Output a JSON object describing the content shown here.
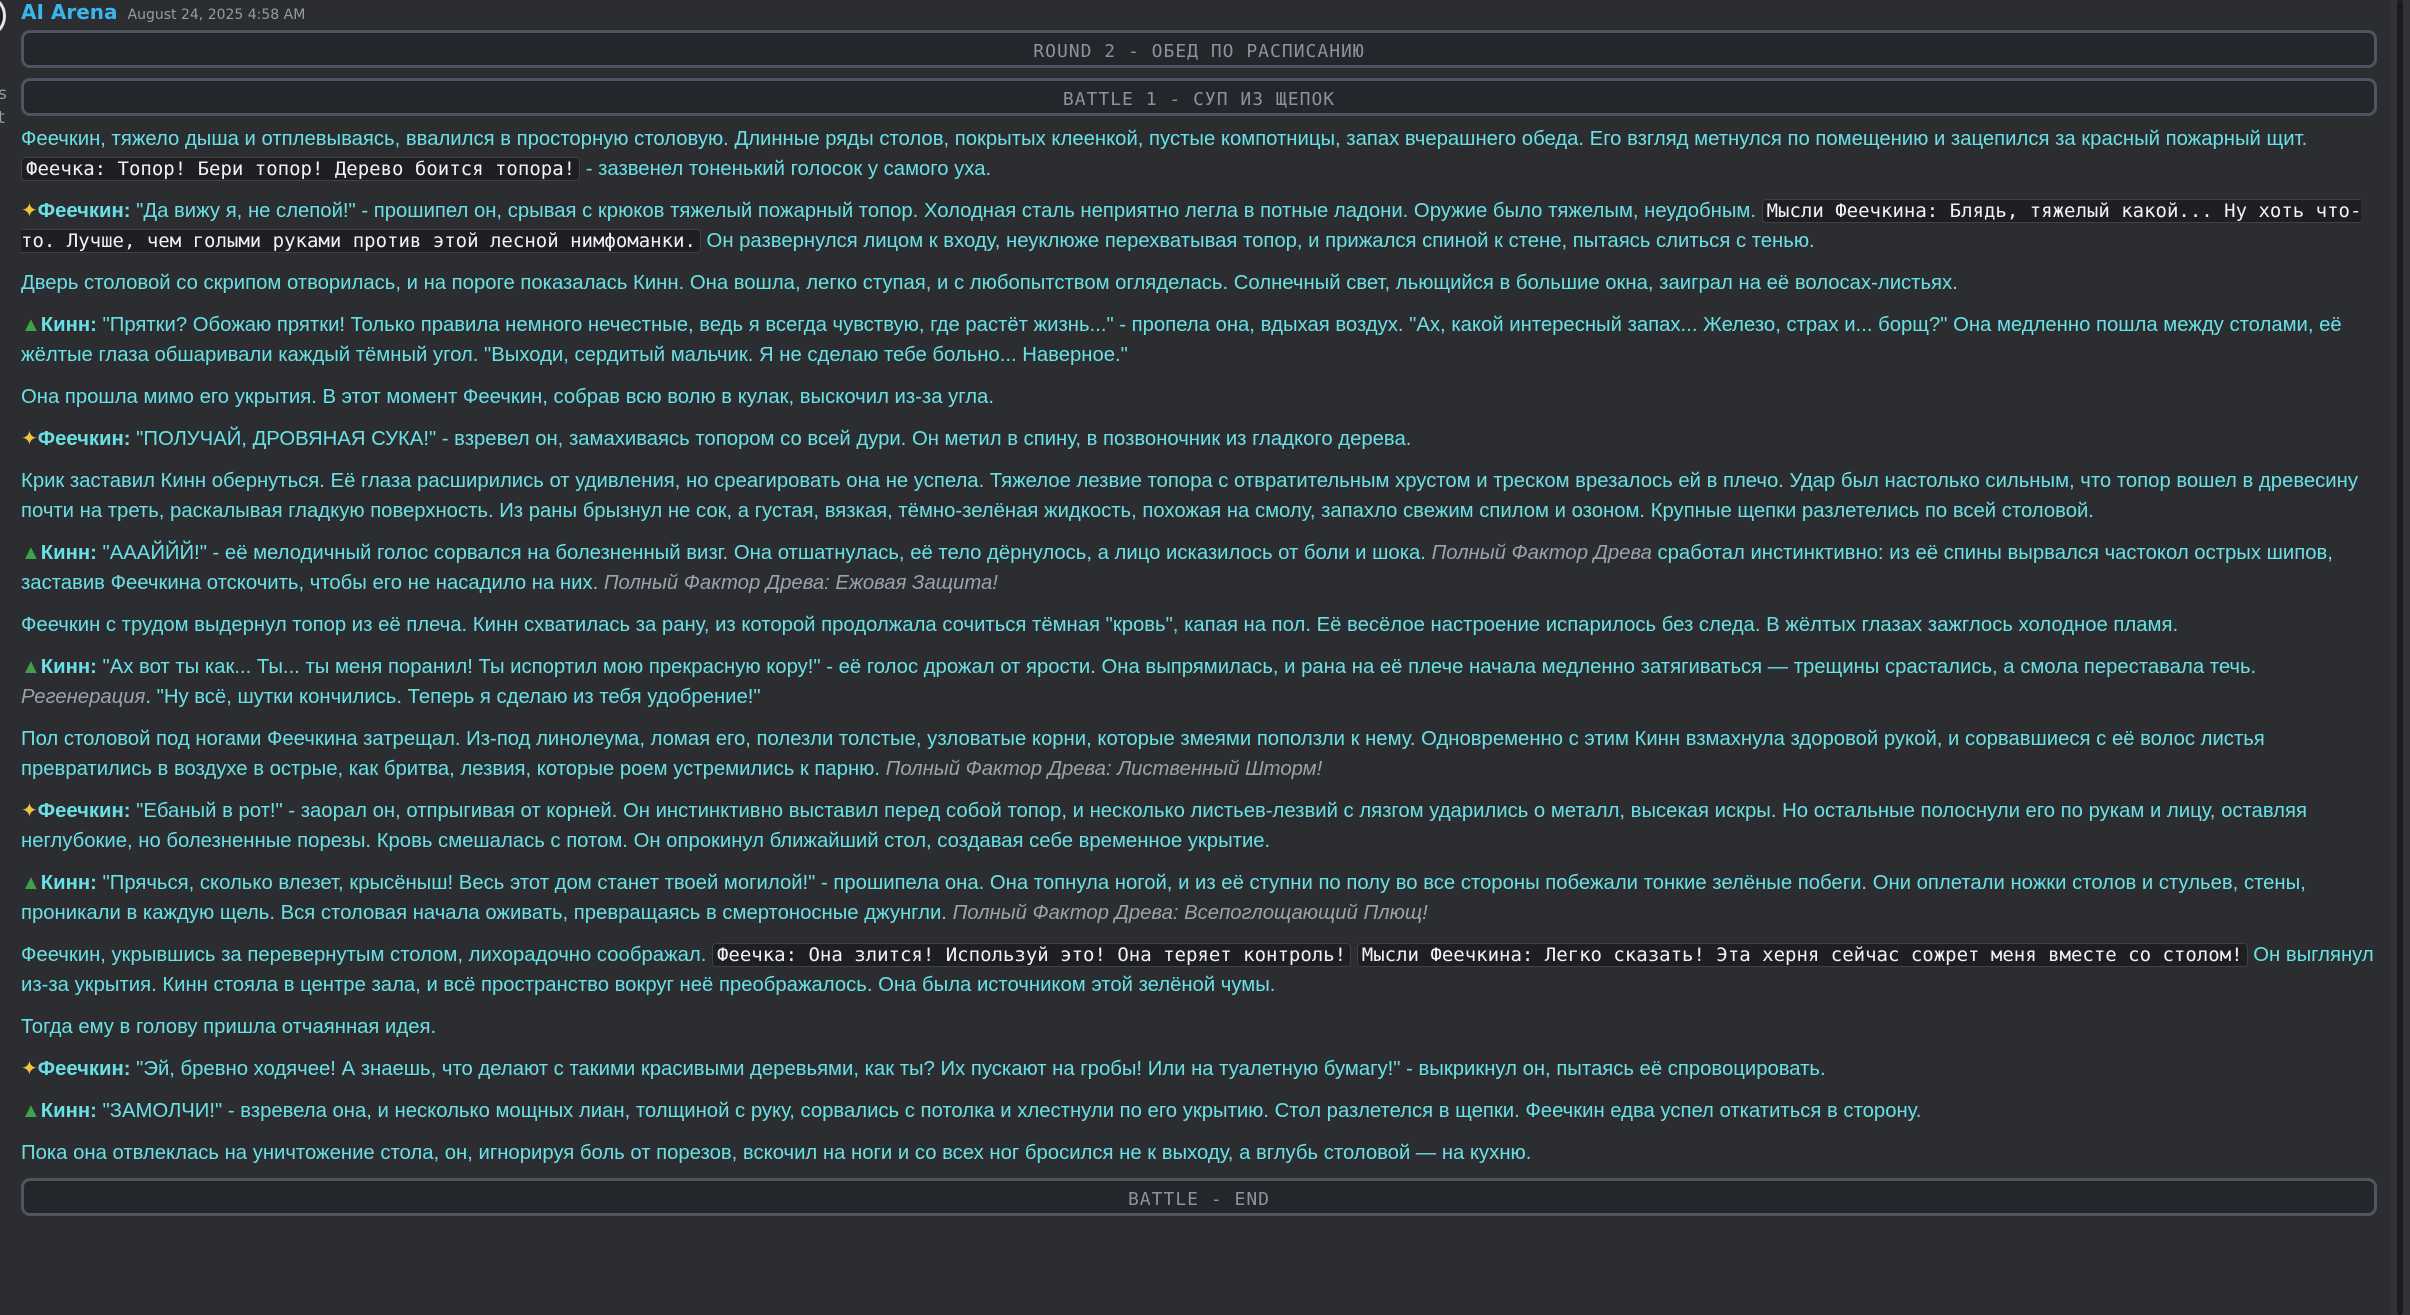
{
  "message": {
    "author": "AI Arena",
    "timestamp": "August 24, 2025 4:58 AM"
  },
  "sidebar_fragments": [
    "s",
    "t"
  ],
  "banners": {
    "round": "ROUND 2 - ОБЕД ПО РАСПИСАНИЮ",
    "battle": "BATTLE 1 - СУП ИЗ ЩЕПОК",
    "end": "BATTLE - END"
  },
  "colors": {
    "author": "#3cb4ec",
    "narrative_text": "#69e0e4",
    "hint_text": "#9aa3ad",
    "code_background": "#1e1f22",
    "banner_border": "#4e5560",
    "background": "#2b2d31"
  },
  "icons": {
    "feechkin": "fairy-icon",
    "kinn": "evergreen-tree-icon"
  },
  "paragraphs": [
    {
      "type": "narration",
      "segments": [
        {
          "kind": "text",
          "text": "Феечкин, тяжело дыша и отплевываясь, ввалился в просторную столовую. Длинные ряды столов, покрытых клеенкой, пустые компотницы, запах вчерашнего обеда. Его взгляд метнулся по помещению и зацепился за красный пожарный щит. "
        },
        {
          "kind": "code",
          "text": "Феечка: Топор! Бери топор! Дерево боится топора!"
        },
        {
          "kind": "text",
          "text": " - зазвенел тоненький голосок у самого уха."
        }
      ]
    },
    {
      "type": "dialogue",
      "speaker": "Феечкин:",
      "icon": "fairy",
      "segments": [
        {
          "kind": "text",
          "text": " \"Да вижу я, не слепой!\" - прошипел он, срывая с крюков тяжелый пожарный топор. Холодная сталь неприятно легла в потные ладони. Оружие было тяжелым, неудобным. "
        },
        {
          "kind": "code",
          "text": "Мысли Феечкина: Блядь, тяжелый какой... Ну хоть что-то. Лучше, чем голыми руками против этой лесной нимфоманки."
        },
        {
          "kind": "text",
          "text": " Он развернулся лицом к входу, неуклюже перехватывая топор, и прижался спиной к стене, пытаясь слиться с тенью."
        }
      ]
    },
    {
      "type": "narration",
      "segments": [
        {
          "kind": "text",
          "text": "Дверь столовой со скрипом отворилась, и на пороге показалась Кинн. Она вошла, легко ступая, и с любопытством огляделась. Солнечный свет, льющийся в большие окна, заиграл на её волосах-листьях."
        }
      ]
    },
    {
      "type": "dialogue",
      "speaker": "Кинн:",
      "icon": "tree",
      "segments": [
        {
          "kind": "text",
          "text": " \"Прятки? Обожаю прятки! Только правила немного нечестные, ведь я всегда чувствую, где растёт жизнь...\" - пропела она, вдыхая воздух. \"Ах, какой интересный запах... Железо, страх и... борщ?\" Она медленно пошла между столами, её жёлтые глаза обшаривали каждый тёмный угол. \"Выходи, сердитый мальчик. Я не сделаю тебе больно... Наверное.\""
        }
      ]
    },
    {
      "type": "narration",
      "segments": [
        {
          "kind": "text",
          "text": "Она прошла мимо его укрытия. В этот момент Феечкин, собрав всю волю в кулак, выскочил из-за угла."
        }
      ]
    },
    {
      "type": "dialogue",
      "speaker": "Феечкин:",
      "icon": "fairy",
      "segments": [
        {
          "kind": "text",
          "text": " \"ПОЛУЧАЙ, ДРОВЯНАЯ СУКА!\" - взревел он, замахиваясь топором со всей дури. Он метил в спину, в позвоночник из гладкого дерева."
        }
      ]
    },
    {
      "type": "narration",
      "segments": [
        {
          "kind": "text",
          "text": "Крик заставил Кинн обернуться. Её глаза расширились от удивления, но среагировать она не успела. Тяжелое лезвие топора с отвратительным хрустом и треском врезалось ей в плечо. Удар был настолько сильным, что топор вошел в древесину почти на треть, раскалывая гладкую поверхность. Из раны брызнул не сок, а густая, вязкая, тёмно-зелёная жидкость, похожая на смолу, запахло свежим спилом и озоном. Крупные щепки разлетелись по всей столовой."
        }
      ]
    },
    {
      "type": "dialogue",
      "speaker": "Кинн:",
      "icon": "tree",
      "segments": [
        {
          "kind": "text",
          "text": " \"АААЙЙЙ!\" - её мелодичный голос сорвался на болезненный визг. Она отшатнулась, её тело дёрнулось, а лицо исказилось от боли и шока. "
        },
        {
          "kind": "hint",
          "text": "Полный Фактор Древа"
        },
        {
          "kind": "text",
          "text": " сработал инстинктивно: из её спины вырвался частокол острых шипов, заставив Феечкина отскочить, чтобы его не насадило на них. "
        },
        {
          "kind": "hint",
          "text": "Полный Фактор Древа: Ежовая Защита!"
        }
      ]
    },
    {
      "type": "narration",
      "segments": [
        {
          "kind": "text",
          "text": "Феечкин с трудом выдернул топор из её плеча. Кинн схватилась за рану, из которой продолжала сочиться тёмная \"кровь\", капая на пол. Её весёлое настроение испарилось без следа. В жёлтых глазах зажглось холодное пламя."
        }
      ]
    },
    {
      "type": "dialogue",
      "speaker": "Кинн:",
      "icon": "tree",
      "segments": [
        {
          "kind": "text",
          "text": " \"Ах вот ты как... Ты... ты меня поранил! Ты испортил мою прекрасную кору!\" - её голос дрожал от ярости. Она выпрямилась, и рана на её плече начала медленно затягиваться — трещины срастались, а смола переставала течь. "
        },
        {
          "kind": "hint",
          "text": "Регенерация"
        },
        {
          "kind": "text",
          "text": ". \"Ну всё, шутки кончились. Теперь я сделаю из тебя удобрение!\""
        }
      ]
    },
    {
      "type": "narration",
      "segments": [
        {
          "kind": "text",
          "text": "Пол столовой под ногами Феечкина затрещал. Из-под линолеума, ломая его, полезли толстые, узловатые корни, которые змеями поползли к нему. Одновременно с этим Кинн взмахнула здоровой рукой, и сорвавшиеся с её волос листья превратились в воздухе в острые, как бритва, лезвия, которые роем устремились к парню. "
        },
        {
          "kind": "hint",
          "text": "Полный Фактор Древа: Лиственный Шторм!"
        }
      ]
    },
    {
      "type": "dialogue",
      "speaker": "Феечкин:",
      "icon": "fairy",
      "segments": [
        {
          "kind": "text",
          "text": " \"Ебаный в рот!\" - заорал он, отпрыгивая от корней. Он инстинктивно выставил перед собой топор, и несколько листьев-лезвий с лязгом ударились о металл, высекая искры. Но остальные полоснули его по рукам и лицу, оставляя неглубокие, но болезненные порезы. Кровь смешалась с потом. Он опрокинул ближайший стол, создавая себе временное укрытие."
        }
      ]
    },
    {
      "type": "dialogue",
      "speaker": "Кинн:",
      "icon": "tree",
      "segments": [
        {
          "kind": "text",
          "text": " \"Прячься, сколько влезет, крысёныш! Весь этот дом станет твоей могилой!\" - прошипела она. Она топнула ногой, и из её ступни по полу во все стороны побежали тонкие зелёные побеги. Они оплетали ножки столов и стульев, стены, проникали в каждую щель. Вся столовая начала оживать, превращаясь в смертоносные джунгли. "
        },
        {
          "kind": "hint",
          "text": "Полный Фактор Древа: Всепоглощающий Плющ!"
        }
      ]
    },
    {
      "type": "narration",
      "segments": [
        {
          "kind": "text",
          "text": "Феечкин, укрывшись за перевернутым столом, лихорадочно соображал. "
        },
        {
          "kind": "code",
          "text": "Феечка: Она злится! Используй это! Она теряет контроль!"
        },
        {
          "kind": "text",
          "text": " "
        },
        {
          "kind": "code",
          "text": "Мысли Феечкина: Легко сказать! Эта херня сейчас сожрет меня вместе со столом!"
        },
        {
          "kind": "text",
          "text": " Он выглянул из-за укрытия. Кинн стояла в центре зала, и всё пространство вокруг неё преображалось. Она была источником этой зелёной чумы."
        }
      ]
    },
    {
      "type": "narration",
      "segments": [
        {
          "kind": "text",
          "text": "Тогда ему в голову пришла отчаянная идея."
        }
      ]
    },
    {
      "type": "dialogue",
      "speaker": "Феечкин:",
      "icon": "fairy",
      "segments": [
        {
          "kind": "text",
          "text": " \"Эй, бревно ходячее! А знаешь, что делают с такими красивыми деревьями, как ты? Их пускают на гробы! Или на туалетную бумагу!\" - выкрикнул он, пытаясь её спровоцировать."
        }
      ]
    },
    {
      "type": "dialogue",
      "speaker": "Кинн:",
      "icon": "tree",
      "segments": [
        {
          "kind": "text",
          "text": " \"ЗАМОЛЧИ!\" - взревела она, и несколько мощных лиан, толщиной с руку, сорвались с потолка и хлестнули по его укрытию. Стол разлетелся в щепки. Феечкин едва успел откатиться в сторону."
        }
      ]
    },
    {
      "type": "narration",
      "segments": [
        {
          "kind": "text",
          "text": "Пока она отвлеклась на уничтожение стола, он, игнорируя боль от порезов, вскочил на ноги и со всех ног бросился не к выходу, а вглубь столовой — на кухню."
        }
      ]
    }
  ]
}
